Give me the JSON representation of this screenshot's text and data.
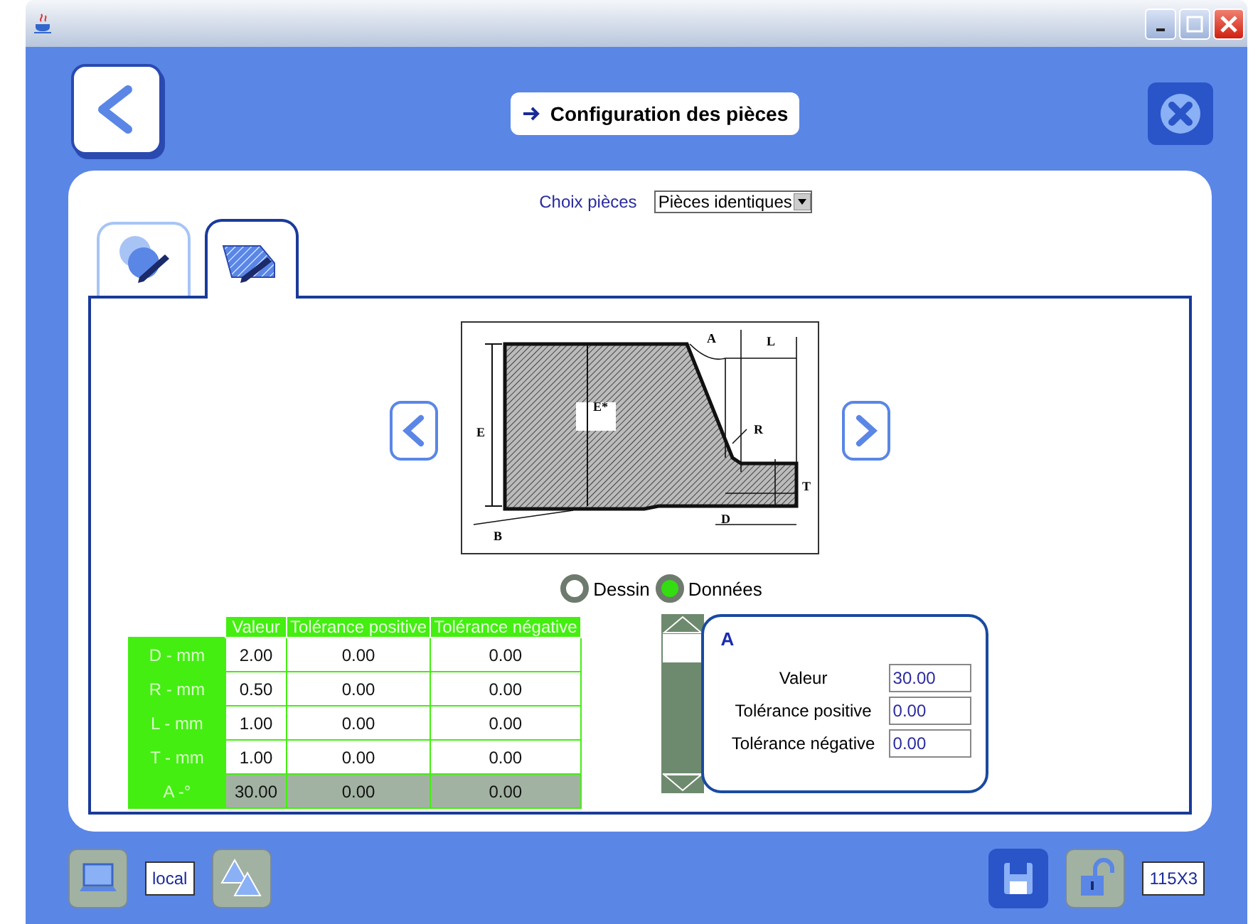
{
  "header": {
    "title": "Configuration des pièces"
  },
  "choice": {
    "label": "Choix pièces",
    "value": "Pièces identiques"
  },
  "tabs": [
    {
      "kind": "shapes",
      "selected": false
    },
    {
      "kind": "hatched",
      "selected": true
    }
  ],
  "drawing": {
    "labels": [
      "E",
      "E*",
      "A",
      "L",
      "R",
      "T",
      "D",
      "B"
    ]
  },
  "views": [
    {
      "label": "Dessin",
      "selected": false
    },
    {
      "label": "Données",
      "selected": true
    }
  ],
  "table": {
    "columns": [
      "Valeur",
      "Tolérance positive",
      "Tolérance négative"
    ],
    "rows": [
      {
        "label": "D  - mm",
        "cells": [
          "2.00",
          "0.00",
          "0.00"
        ],
        "selected": false
      },
      {
        "label": "R  - mm",
        "cells": [
          "0.50",
          "0.00",
          "0.00"
        ],
        "selected": false
      },
      {
        "label": "L  - mm",
        "cells": [
          "1.00",
          "0.00",
          "0.00"
        ],
        "selected": false
      },
      {
        "label": "T  - mm",
        "cells": [
          "1.00",
          "0.00",
          "0.00"
        ],
        "selected": false
      },
      {
        "label": "A  -°",
        "cells": [
          "30.00",
          "0.00",
          "0.00"
        ],
        "selected": true
      }
    ]
  },
  "detail": {
    "title": "A",
    "fields": [
      {
        "label": "Valeur",
        "value": "30.00"
      },
      {
        "label": "Tolérance positive",
        "value": "0.00"
      },
      {
        "label": "Tolérance négative",
        "value": "0.00"
      }
    ]
  },
  "footer": {
    "connection": "local",
    "size": "115X3"
  }
}
